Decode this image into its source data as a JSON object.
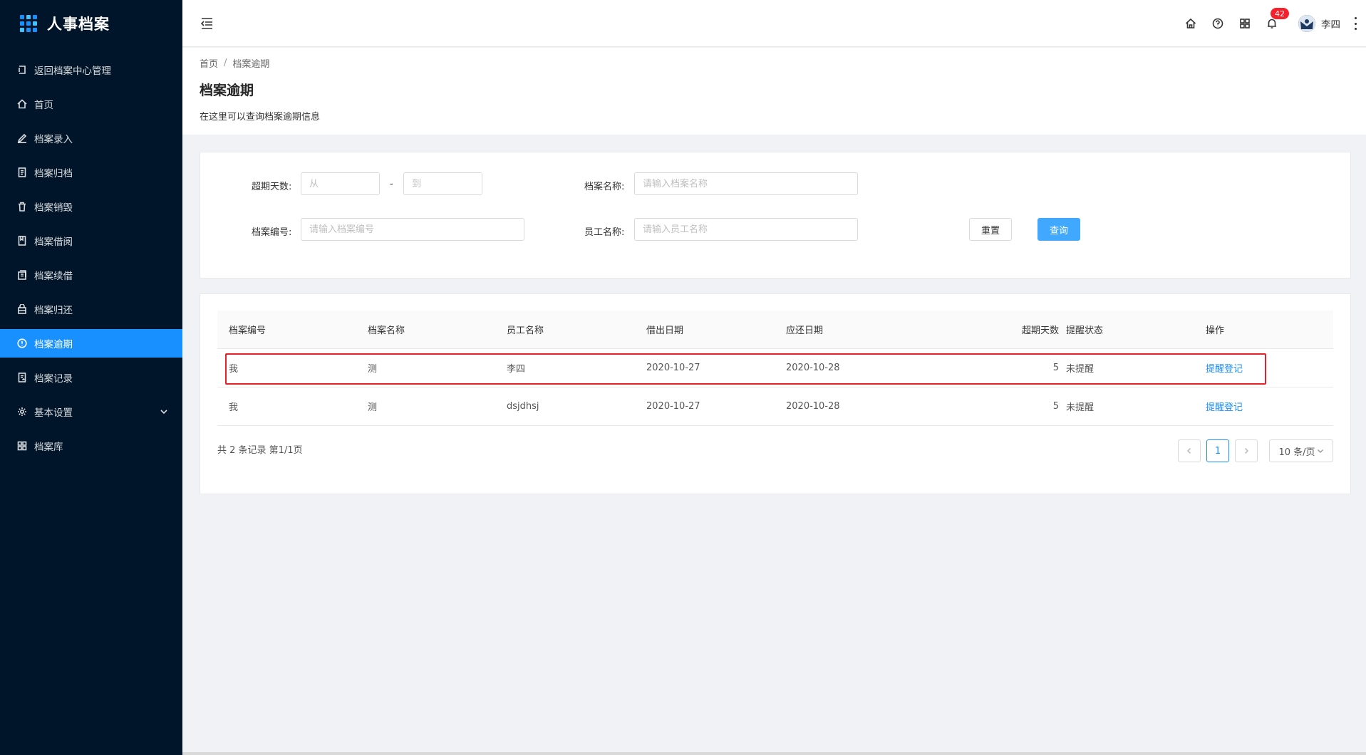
{
  "app": {
    "title": "人事档案"
  },
  "sidebar": {
    "items": [
      {
        "label": "返回档案中心管理",
        "icon": "back-icon"
      },
      {
        "label": "首页",
        "icon": "home-icon"
      },
      {
        "label": "档案录入",
        "icon": "edit-icon"
      },
      {
        "label": "档案归档",
        "icon": "file-icon"
      },
      {
        "label": "档案销毁",
        "icon": "trash-icon"
      },
      {
        "label": "档案借阅",
        "icon": "book-icon"
      },
      {
        "label": "档案续借",
        "icon": "renew-icon"
      },
      {
        "label": "档案归还",
        "icon": "return-icon"
      },
      {
        "label": "档案逾期",
        "icon": "alert-icon",
        "active": true
      },
      {
        "label": "档案记录",
        "icon": "record-icon"
      },
      {
        "label": "基本设置",
        "icon": "gear-icon"
      },
      {
        "label": "档案库",
        "icon": "grid-icon"
      }
    ]
  },
  "header": {
    "notification_count": "42",
    "username": "李四"
  },
  "page": {
    "breadcrumb": [
      "首页",
      "档案逾期"
    ],
    "title": "档案逾期",
    "description": "在这里可以查询档案逾期信息"
  },
  "search": {
    "overdue_label": "超期天数:",
    "from_placeholder": "从",
    "dash": "-",
    "to_placeholder": "到",
    "name_label": "档案名称:",
    "name_placeholder": "请输入档案名称",
    "code_label": "档案编号:",
    "code_placeholder": "请输入档案编号",
    "employee_label": "员工名称:",
    "employee_placeholder": "请输入员工名称",
    "reset_label": "重置",
    "query_label": "查询"
  },
  "table": {
    "columns": [
      "档案编号",
      "档案名称",
      "员工名称",
      "借出日期",
      "应还日期",
      "超期天数",
      "提醒状态",
      "操作"
    ],
    "rows": [
      {
        "code": "我",
        "name": "测",
        "employee": "李四",
        "borrow_date": "2020-10-27",
        "due_date": "2020-10-28",
        "overdue_days": "5",
        "status": "未提醒",
        "action": "提醒登记"
      },
      {
        "code": "我",
        "name": "测",
        "employee": "dsjdhsj",
        "borrow_date": "2020-10-27",
        "due_date": "2020-10-28",
        "overdue_days": "5",
        "status": "未提醒",
        "action": "提醒登记"
      }
    ]
  },
  "pagination": {
    "total_text": "共 2 条记录 第1/1页",
    "current_page": "1",
    "page_size": "10 条/页"
  },
  "colors": {
    "sidebar_bg": "#001529",
    "accent": "#1890ff",
    "highlight_border": "#e6212a"
  }
}
